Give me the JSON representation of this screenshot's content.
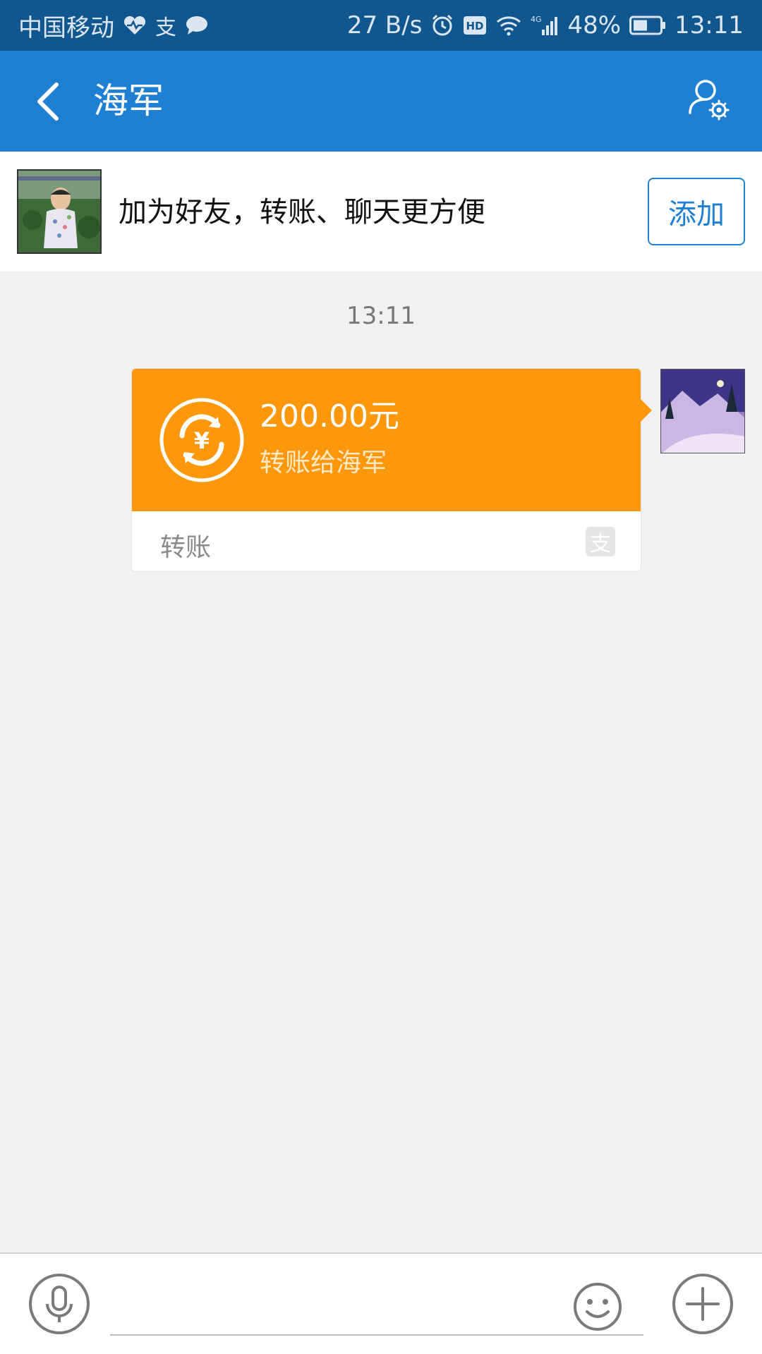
{
  "status_bar": {
    "carrier": "中国移动",
    "network_speed": "27 B/s",
    "battery": "48%",
    "time": "13:11",
    "icons": [
      "heart-rate-icon",
      "alipay-icon",
      "message-icon",
      "alarm-icon",
      "hd-icon",
      "wifi-icon",
      "signal-4g-icon",
      "battery-icon"
    ]
  },
  "header": {
    "title": "海军",
    "back_icon": "chevron-left-icon",
    "settings_icon": "user-settings-icon"
  },
  "banner": {
    "text": "加为好友，转账、聊天更方便",
    "add_button_label": "添加"
  },
  "chat": {
    "timestamp": "13:11",
    "transfer": {
      "amount": "200.00元",
      "description": "转账给海军",
      "footer_label": "转账",
      "accent_color": "#fd980c"
    }
  },
  "input_bar": {
    "placeholder": "",
    "icons": [
      "microphone-icon",
      "emoji-icon",
      "plus-icon"
    ]
  }
}
